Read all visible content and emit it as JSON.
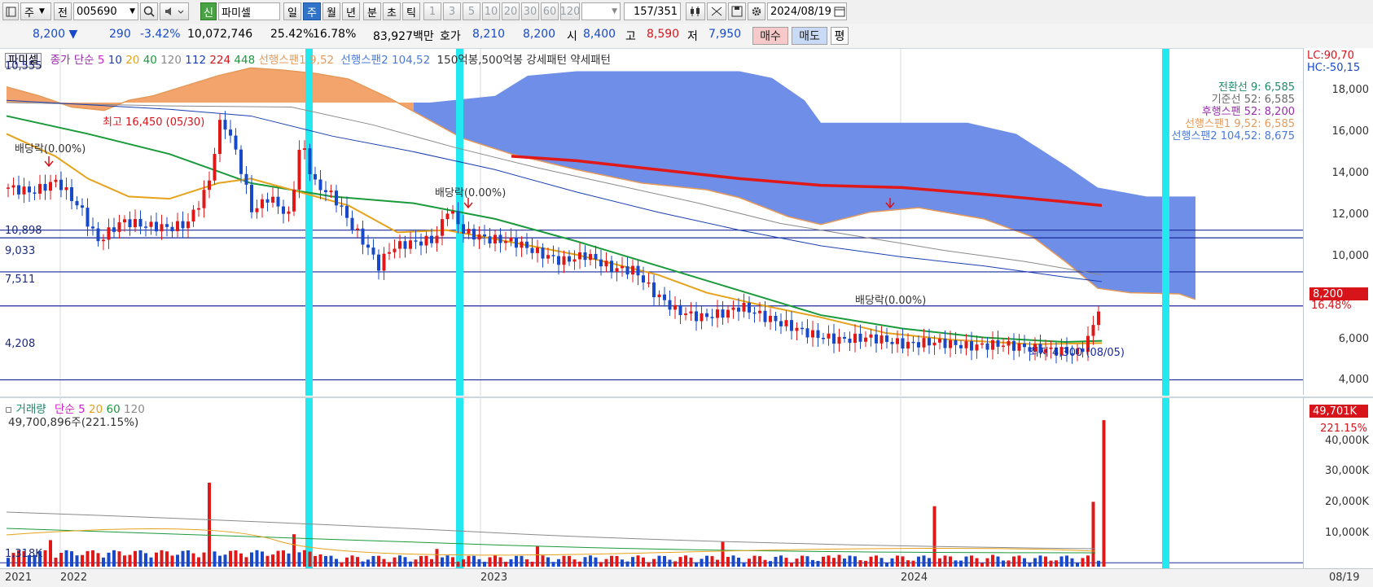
{
  "toolbar": {
    "period_type": "주",
    "prev_label": "전",
    "stock_code": "005690",
    "badge": "신",
    "stock_name": "파미셀",
    "periods": [
      "일",
      "주",
      "월",
      "년",
      "분",
      "초",
      "틱"
    ],
    "active_period": "주",
    "intervals": [
      "1",
      "3",
      "5",
      "10",
      "20",
      "30",
      "60",
      "120"
    ],
    "count": "157",
    "total": "/351",
    "date": "2024/08/19"
  },
  "quote": {
    "price": "8,200",
    "change": "290",
    "change_pct": "-3.42%",
    "volume": "10,072,746",
    "vol_ratio": "25.42%",
    "turnover": "16.78%",
    "amount": "83,927백만",
    "hoga_label": "호가",
    "ask": "8,210",
    "bid": "8,200",
    "open_label": "시",
    "open": "8,400",
    "high_label": "고",
    "high": "8,590",
    "low_label": "저",
    "low": "7,950",
    "buy_label": "매수",
    "sell_label": "매도",
    "eval_label": "평"
  },
  "price_panel": {
    "legend": {
      "name": "파미셀",
      "close_label": "종가 단순",
      "ma": [
        {
          "label": "5",
          "color": "#d020c8"
        },
        {
          "label": "10",
          "color": "#1a3fb0"
        },
        {
          "label": "20",
          "color": "#e5a21a"
        },
        {
          "label": "40",
          "color": "#1a9a3a"
        },
        {
          "label": "120",
          "color": "#8a8a8a"
        },
        {
          "label": "112",
          "color": "#1a3fb0"
        },
        {
          "label": "224",
          "color": "#d8141b"
        },
        {
          "label": "448",
          "color": "#1a9a3a"
        }
      ],
      "span1": "선행스팬1 9,52",
      "span2": "선행스팬2 104,52",
      "pattern": "150억봉,500억봉 강세패턴  약세패턴"
    },
    "ichimoku": [
      {
        "text": "전환선 9: 6,585",
        "color": "#1a8a6a"
      },
      {
        "text": "기준선 52: 6,585",
        "color": "#6a6a6a"
      },
      {
        "text": "후행스팬 52: 8,200",
        "color": "#9a2ab0"
      },
      {
        "text": "선행스팬1 9,52: 6,585",
        "color": "#e59a5a"
      },
      {
        "text": "선행스팬2 104,52: 8,675",
        "color": "#4a7ad8"
      }
    ],
    "levels": [
      "10,555",
      "10,898",
      "9,033",
      "7,511",
      "4,208"
    ],
    "y_ticks": [
      "18,000",
      "16,000",
      "14,000",
      "12,000",
      "10,000",
      "6,000",
      "4,000"
    ],
    "lc": "LC:90,70",
    "hc": "HC:-50,15",
    "current_price": "8,200",
    "current_pct": "16.48%",
    "high_note": "최고 16,450 (05/30)",
    "low_note": "최저 4,300 (08/05)",
    "dividend_notes": [
      "배당락(0.00%)",
      "배당락(0.00%)",
      "배당락(0.00%)"
    ]
  },
  "volume_panel": {
    "legend_name": "거래량",
    "legend_ma": "단순 5",
    "legend_ma_vals": [
      {
        "label": "20",
        "color": "#e5a21a"
      },
      {
        "label": "60",
        "color": "#1a9a3a"
      },
      {
        "label": "120",
        "color": "#8a8a8a"
      }
    ],
    "volume_text": "49,700,896주(221.15%)",
    "y_ticks": [
      "40,000K",
      "30,000K",
      "20,000K",
      "10,000K"
    ],
    "low_level": "1,318K",
    "current_volume": "49,701K",
    "current_pct": "221.15%"
  },
  "x_axis": {
    "labels": [
      "2021",
      "2022",
      "2023",
      "2024"
    ],
    "end_date": "08/19"
  },
  "chart_data": {
    "type": "candlestick-weekly",
    "price_ylim": [
      3500,
      19000
    ],
    "levels": [
      10555,
      10898,
      9033,
      7511,
      4208
    ],
    "close_path": [
      [
        0,
        12800
      ],
      [
        30,
        12600
      ],
      [
        60,
        13100
      ],
      [
        90,
        11800
      ],
      [
        110,
        10400
      ],
      [
        140,
        11300
      ],
      [
        170,
        11100
      ],
      [
        200,
        11000
      ],
      [
        220,
        11200
      ],
      [
        245,
        12800
      ],
      [
        262,
        16000
      ],
      [
        280,
        14400
      ],
      [
        300,
        11700
      ],
      [
        320,
        12400
      ],
      [
        345,
        11500
      ],
      [
        360,
        15000
      ],
      [
        375,
        13000
      ],
      [
        400,
        12400
      ],
      [
        420,
        11200
      ],
      [
        440,
        10200
      ],
      [
        455,
        9300
      ],
      [
        470,
        10100
      ],
      [
        490,
        10300
      ],
      [
        510,
        10400
      ],
      [
        525,
        10500
      ],
      [
        540,
        11900
      ],
      [
        560,
        10800
      ],
      [
        590,
        10500
      ],
      [
        620,
        10400
      ],
      [
        650,
        9900
      ],
      [
        680,
        9500
      ],
      [
        710,
        9800
      ],
      [
        740,
        9200
      ],
      [
        770,
        9100
      ],
      [
        790,
        8200
      ],
      [
        820,
        7300
      ],
      [
        850,
        7000
      ],
      [
        880,
        7200
      ],
      [
        900,
        7500
      ],
      [
        930,
        7000
      ],
      [
        960,
        6600
      ],
      [
        990,
        6200
      ],
      [
        1020,
        6000
      ],
      [
        1060,
        6100
      ],
      [
        1100,
        5800
      ],
      [
        1140,
        5900
      ],
      [
        1180,
        5700
      ],
      [
        1220,
        5800
      ],
      [
        1260,
        5600
      ],
      [
        1290,
        5500
      ],
      [
        1315,
        5400
      ],
      [
        1330,
        6300
      ],
      [
        1345,
        8200
      ]
    ],
    "cloud_span1": [
      [
        0,
        17300
      ],
      [
        40,
        16900
      ],
      [
        80,
        16400
      ],
      [
        120,
        16250
      ],
      [
        150,
        16700
      ],
      [
        180,
        16900
      ],
      [
        220,
        17350
      ],
      [
        260,
        17800
      ],
      [
        300,
        18150
      ],
      [
        340,
        18050
      ],
      [
        380,
        17900
      ],
      [
        420,
        17650
      ],
      [
        470,
        16800
      ],
      [
        520,
        15800
      ],
      [
        560,
        15000
      ],
      [
        620,
        14300
      ],
      [
        700,
        13600
      ],
      [
        780,
        13000
      ],
      [
        860,
        12700
      ],
      [
        900,
        12350
      ],
      [
        960,
        11500
      ],
      [
        1000,
        11150
      ],
      [
        1060,
        11700
      ],
      [
        1120,
        11900
      ],
      [
        1200,
        11400
      ],
      [
        1260,
        10600
      ],
      [
        1300,
        9500
      ],
      [
        1340,
        8300
      ],
      [
        1380,
        8100
      ],
      [
        1440,
        8050
      ],
      [
        1460,
        7800
      ]
    ],
    "cloud_span2": [
      [
        0,
        16600
      ],
      [
        200,
        16600
      ],
      [
        470,
        16600
      ],
      [
        520,
        16600
      ],
      [
        600,
        16900
      ],
      [
        640,
        17800
      ],
      [
        700,
        18000
      ],
      [
        780,
        18000
      ],
      [
        900,
        18000
      ],
      [
        940,
        17700
      ],
      [
        980,
        16700
      ],
      [
        1000,
        15700
      ],
      [
        1060,
        15700
      ],
      [
        1120,
        15700
      ],
      [
        1180,
        15700
      ],
      [
        1240,
        15200
      ],
      [
        1300,
        13800
      ],
      [
        1340,
        12800
      ],
      [
        1400,
        12400
      ],
      [
        1460,
        12400
      ]
    ],
    "ma_long_red": [
      [
        620,
        14200
      ],
      [
        700,
        14000
      ],
      [
        800,
        13600
      ],
      [
        900,
        13200
      ],
      [
        1000,
        12900
      ],
      [
        1100,
        12800
      ],
      [
        1200,
        12500
      ],
      [
        1290,
        12200
      ],
      [
        1345,
        12000
      ]
    ],
    "ma_green": [
      [
        0,
        16000
      ],
      [
        100,
        15200
      ],
      [
        200,
        14300
      ],
      [
        300,
        13000
      ],
      [
        400,
        12400
      ],
      [
        500,
        12100
      ],
      [
        600,
        11400
      ],
      [
        700,
        10400
      ],
      [
        800,
        9300
      ],
      [
        900,
        8200
      ],
      [
        1000,
        7100
      ],
      [
        1100,
        6500
      ],
      [
        1200,
        6100
      ],
      [
        1300,
        5900
      ],
      [
        1345,
        5950
      ]
    ],
    "ma_orange": [
      [
        0,
        15200
      ],
      [
        60,
        14200
      ],
      [
        100,
        13200
      ],
      [
        150,
        12400
      ],
      [
        200,
        12300
      ],
      [
        260,
        13000
      ],
      [
        300,
        13200
      ],
      [
        360,
        12600
      ],
      [
        420,
        12000
      ],
      [
        480,
        10800
      ],
      [
        540,
        10900
      ],
      [
        600,
        10500
      ],
      [
        700,
        9800
      ],
      [
        800,
        8900
      ],
      [
        860,
        8100
      ],
      [
        920,
        7600
      ],
      [
        1000,
        7000
      ],
      [
        1080,
        6300
      ],
      [
        1160,
        6000
      ],
      [
        1260,
        5800
      ],
      [
        1345,
        5850
      ]
    ],
    "ma_navy": [
      [
        0,
        16700
      ],
      [
        200,
        16300
      ],
      [
        300,
        16000
      ],
      [
        400,
        15100
      ],
      [
        500,
        14400
      ],
      [
        600,
        13600
      ],
      [
        700,
        12600
      ],
      [
        800,
        11700
      ],
      [
        900,
        10900
      ],
      [
        1000,
        10200
      ],
      [
        1100,
        9700
      ],
      [
        1200,
        9300
      ],
      [
        1300,
        8800
      ],
      [
        1345,
        8600
      ]
    ],
    "ma_gray": [
      [
        0,
        16600
      ],
      [
        200,
        16450
      ],
      [
        350,
        16400
      ],
      [
        450,
        15600
      ],
      [
        550,
        14600
      ],
      [
        650,
        13700
      ],
      [
        750,
        12900
      ],
      [
        850,
        12100
      ],
      [
        950,
        11200
      ],
      [
        1050,
        10600
      ],
      [
        1150,
        10000
      ],
      [
        1250,
        9500
      ],
      [
        1345,
        8900
      ]
    ],
    "volume_ylim": [
      0,
      50000
    ],
    "volume_spikes": [
      [
        55,
        9000
      ],
      [
        250,
        28500
      ],
      [
        350,
        11000
      ],
      [
        525,
        6000
      ],
      [
        650,
        7000
      ],
      [
        880,
        8500
      ],
      [
        1020,
        4000
      ],
      [
        1135,
        20500
      ],
      [
        1210,
        4000
      ],
      [
        1330,
        22000
      ],
      [
        1345,
        49700
      ]
    ]
  }
}
